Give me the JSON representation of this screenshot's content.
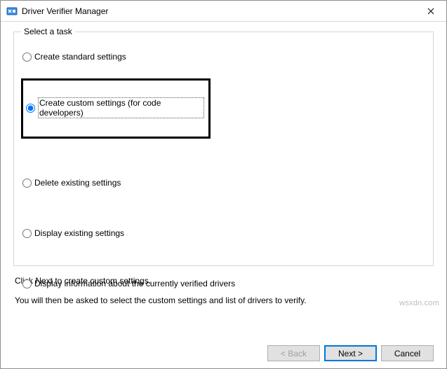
{
  "window": {
    "title": "Driver Verifier Manager"
  },
  "fieldset": {
    "legend": "Select a task",
    "options": {
      "standard": "Create standard settings",
      "custom": "Create custom settings (for code developers)",
      "delete": "Delete existing settings",
      "display": "Display existing settings",
      "info": "Display information about the currently verified drivers"
    },
    "selected": "custom"
  },
  "hints": {
    "line1": "Click Next to create custom settings.",
    "line2": "You will then be asked to select the custom settings and list of drivers to verify."
  },
  "buttons": {
    "back": "< Back",
    "next": "Next >",
    "cancel": "Cancel"
  },
  "watermark": "wsxdn.com"
}
